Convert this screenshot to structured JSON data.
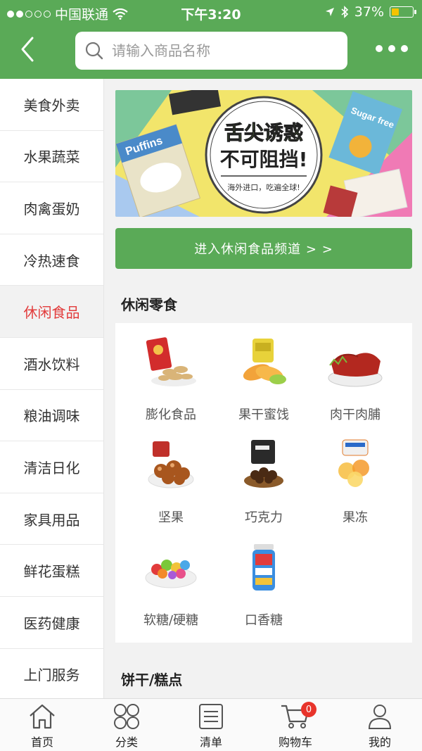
{
  "status_bar": {
    "carrier": "中国联通",
    "time": "下午3:20",
    "battery": "37%",
    "battery_level": 0.37
  },
  "header": {
    "search_placeholder": "请输入商品名称"
  },
  "sidebar": {
    "items": [
      {
        "label": "美食外卖"
      },
      {
        "label": "水果蔬菜"
      },
      {
        "label": "肉禽蛋奶"
      },
      {
        "label": "冷热速食"
      },
      {
        "label": "休闲食品",
        "active": true
      },
      {
        "label": "酒水饮料"
      },
      {
        "label": "粮油调味"
      },
      {
        "label": "清洁日化"
      },
      {
        "label": "家具用品"
      },
      {
        "label": "鲜花蛋糕"
      },
      {
        "label": "医药健康"
      },
      {
        "label": "上门服务"
      }
    ]
  },
  "banner": {
    "headline_1": "舌尖诱惑",
    "headline_2": "不可阻挡!",
    "subline": "海外进口，吃遍全球!",
    "brand_a": "Puffins",
    "brand_b": "Sugar free",
    "colors": [
      "#f2e56b",
      "#7cc79a",
      "#f07ab5",
      "#a9c9ef"
    ]
  },
  "channel_button": {
    "label": "进入休闲食品频道 > >"
  },
  "sections": [
    {
      "title": "休闲零食",
      "items": [
        {
          "label": "膨化食品",
          "icon": "puffed-snack-icon"
        },
        {
          "label": "果干蜜饯",
          "icon": "dried-fruit-icon"
        },
        {
          "label": "肉干肉脯",
          "icon": "jerky-icon"
        },
        {
          "label": "坚果",
          "icon": "nuts-icon"
        },
        {
          "label": "巧克力",
          "icon": "chocolate-icon"
        },
        {
          "label": "果冻",
          "icon": "jelly-icon"
        },
        {
          "label": "软糖/硬糖",
          "icon": "candy-icon"
        },
        {
          "label": "口香糖",
          "icon": "chewing-gum-icon"
        }
      ]
    },
    {
      "title": "饼干/糕点"
    }
  ],
  "tabbar": {
    "items": [
      {
        "label": "首页",
        "icon": "home-icon"
      },
      {
        "label": "分类",
        "icon": "category-icon"
      },
      {
        "label": "清单",
        "icon": "list-icon"
      },
      {
        "label": "购物车",
        "icon": "cart-icon",
        "badge": "0"
      },
      {
        "label": "我的",
        "icon": "user-icon"
      }
    ]
  },
  "colors": {
    "brand_green": "#5aaa57",
    "active_red": "#e23b3b",
    "badge_red": "#e8342b"
  }
}
